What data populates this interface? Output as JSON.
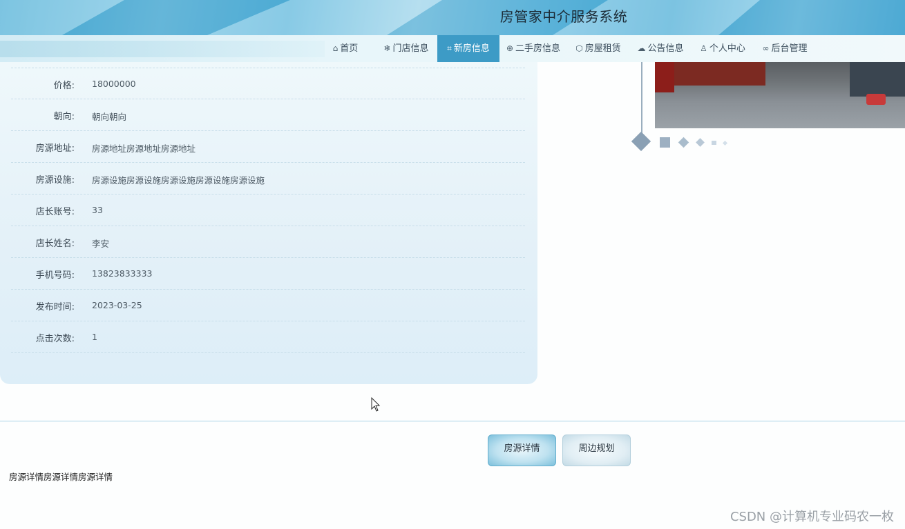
{
  "header": {
    "title": "房管家中介服务系统"
  },
  "nav": {
    "items": [
      {
        "label": "首页",
        "icon": "home-icon",
        "glyph": "⌂",
        "active": false
      },
      {
        "label": "门店信息",
        "icon": "snowflake-icon",
        "glyph": "❄",
        "active": false
      },
      {
        "label": "新房信息",
        "icon": "tag-icon",
        "glyph": "⌗",
        "active": true
      },
      {
        "label": "二手房信息",
        "icon": "globe-icon",
        "glyph": "⊕",
        "active": false
      },
      {
        "label": "房屋租赁",
        "icon": "box-icon",
        "glyph": "⬡",
        "active": false
      },
      {
        "label": "公告信息",
        "icon": "palette-icon",
        "glyph": "☁",
        "active": false
      },
      {
        "label": "个人中心",
        "icon": "user-icon",
        "glyph": "♙",
        "active": false
      },
      {
        "label": "后台管理",
        "icon": "link-icon",
        "glyph": "∞",
        "active": false
      }
    ],
    "active_color": "#3d9bc6"
  },
  "detail": {
    "rows": [
      {
        "label": "价格:",
        "value": "18000000"
      },
      {
        "label": "朝向:",
        "value": "朝向朝向"
      },
      {
        "label": "房源地址:",
        "value": "房源地址房源地址房源地址"
      },
      {
        "label": "房源设施:",
        "value": "房源设施房源设施房源设施房源设施房源设施"
      },
      {
        "label": "店长账号:",
        "value": "33"
      },
      {
        "label": "店长姓名:",
        "value": "李安"
      },
      {
        "label": "手机号码:",
        "value": "13823833333"
      },
      {
        "label": "发布时间:",
        "value": "2023-03-25"
      },
      {
        "label": "点击次数:",
        "value": "1"
      }
    ]
  },
  "tabs": {
    "items": [
      {
        "label": "房源详情",
        "active": true
      },
      {
        "label": "周边规划",
        "active": false
      }
    ],
    "content": "房源详情房源详情房源详情"
  },
  "watermark": "CSDN @计算机专业码农一枚"
}
